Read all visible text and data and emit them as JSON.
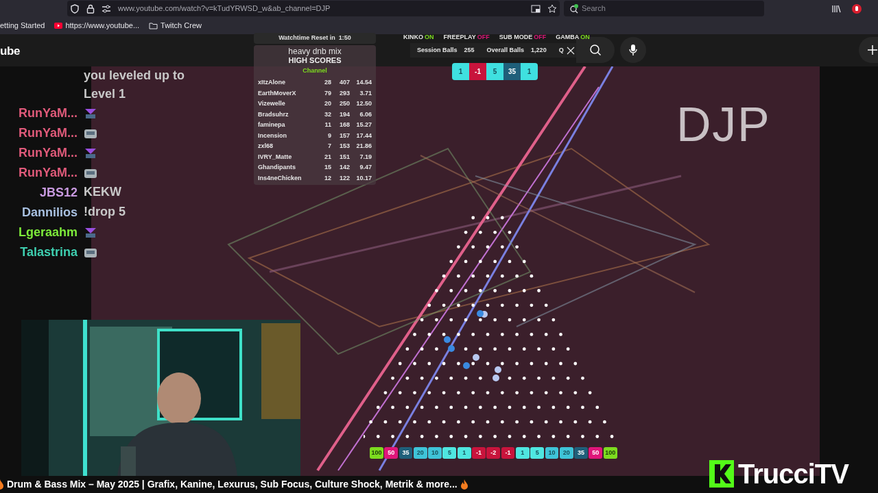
{
  "browser": {
    "url": "www.youtube.com/watch?v=kTudYRWSD_w&ab_channel=DJP",
    "search_placeholder": "Search",
    "bookmarks": [
      {
        "kind": "page",
        "label": "etting Started"
      },
      {
        "kind": "youtube",
        "label": "https://www.youtube..."
      },
      {
        "kind": "folder",
        "label": "Twitch Crew"
      }
    ]
  },
  "youtube": {
    "logo": "ube"
  },
  "hud": {
    "watchtime": "Watchtime Reset in  1:50",
    "playlist": "heavy dnb mix",
    "toggles": [
      {
        "label": "KINKO",
        "state": "ON",
        "on": true
      },
      {
        "label": "FREEPLAY",
        "state": "OFF",
        "on": false
      },
      {
        "label": "SUB MODE",
        "state": "OFF",
        "on": false
      },
      {
        "label": "GAMBA",
        "state": "ON",
        "on": true
      }
    ],
    "stats": [
      {
        "label": "Session Balls",
        "value": "255"
      },
      {
        "label": "Overall Balls",
        "value": "1,220"
      }
    ],
    "queue": "Q",
    "recent_drops": [
      {
        "value": "1",
        "color": "#3fe0e0"
      },
      {
        "value": "-1",
        "color": "#c8143c"
      },
      {
        "value": "5",
        "color": "#3fe0e0"
      },
      {
        "value": "35",
        "color": "#1f5f7a"
      },
      {
        "value": "1",
        "color": "#3fe0e0"
      }
    ]
  },
  "high_scores": {
    "title": "HIGH SCORES",
    "subtitle": "Channel",
    "rows": [
      {
        "name": "xItzAlone",
        "col_2": "28",
        "col_3": "407",
        "col_4": "14.54"
      },
      {
        "name": "EarthMoverX",
        "col_2": "79",
        "col_3": "293",
        "col_4": "3.71"
      },
      {
        "name": "Vizewelle",
        "col_2": "20",
        "col_3": "250",
        "col_4": "12.50"
      },
      {
        "name": "Bradsuhrz",
        "col_2": "32",
        "col_3": "194",
        "col_4": "6.06"
      },
      {
        "name": "faminepa",
        "col_2": "11",
        "col_3": "168",
        "col_4": "15.27"
      },
      {
        "name": "Incension",
        "col_2": "9",
        "col_3": "157",
        "col_4": "17.44"
      },
      {
        "name": "zxl68",
        "col_2": "7",
        "col_3": "153",
        "col_4": "21.86"
      },
      {
        "name": "IVRY_Matte",
        "col_2": "21",
        "col_3": "151",
        "col_4": "7.19"
      },
      {
        "name": "Ghandipants",
        "col_2": "15",
        "col_3": "142",
        "col_4": "9.47"
      },
      {
        "name": "Ins4neChicken",
        "col_2": "12",
        "col_3": "122",
        "col_4": "10.17"
      }
    ]
  },
  "chat": [
    {
      "kind": "text",
      "message": "you leveled up to Level 1"
    },
    {
      "kind": "emote",
      "user": "RunYaM...",
      "color": "#e05a7a"
    },
    {
      "kind": "emote",
      "user": "RunYaM...",
      "color": "#e05a7a"
    },
    {
      "kind": "emote",
      "user": "RunYaM...",
      "color": "#e05a7a"
    },
    {
      "kind": "emote",
      "user": "RunYaM...",
      "color": "#e05a7a"
    },
    {
      "kind": "text",
      "user": "JBS12",
      "color": "#c89ae0",
      "message": "KEKW"
    },
    {
      "kind": "text",
      "user": "Dannilios",
      "color": "#a8c0e0",
      "message": "!drop 5"
    },
    {
      "kind": "emote",
      "user": "Lgeraahm",
      "color": "#7dea3a"
    },
    {
      "kind": "emote",
      "user": "Talastrina",
      "color": "#3ecfb0"
    }
  ],
  "overlay_title": "DJP",
  "bins": [
    {
      "value": "100",
      "color": "#7ddc1f"
    },
    {
      "value": "50",
      "color": "#e0167a"
    },
    {
      "value": "35",
      "color": "#1f5f7a"
    },
    {
      "value": "20",
      "color": "#3fc4d8"
    },
    {
      "value": "10",
      "color": "#3fc4d8"
    },
    {
      "value": "5",
      "color": "#4fe6e0"
    },
    {
      "value": "1",
      "color": "#4fe6e0"
    },
    {
      "value": "-1",
      "color": "#c8143c"
    },
    {
      "value": "-2",
      "color": "#c8143c"
    },
    {
      "value": "-1",
      "color": "#c8143c"
    },
    {
      "value": "1",
      "color": "#4fe6e0"
    },
    {
      "value": "5",
      "color": "#4fe6e0"
    },
    {
      "value": "10",
      "color": "#3fc4d8"
    },
    {
      "value": "20",
      "color": "#3fc4d8"
    },
    {
      "value": "35",
      "color": "#1f5f7a"
    },
    {
      "value": "50",
      "color": "#e0167a"
    },
    {
      "value": "100",
      "color": "#7ddc1f"
    }
  ],
  "brand": "TrucciTV",
  "video_title": "Drum & Bass Mix – May 2025 | Grafix, Kanine, Lexurus, Sub Focus, Culture Shock, Metrik & more..."
}
